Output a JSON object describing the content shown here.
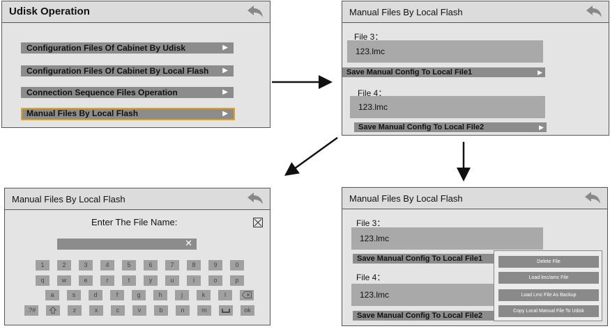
{
  "panel1": {
    "title": "Udisk Operation",
    "items": [
      "Configuration Files Of Cabinet By Udisk",
      "Configuration Files Of Cabinet By Local Flash",
      "Connection Sequence Files Operation",
      "Manual Files By Local Flash"
    ],
    "selected_index": 3
  },
  "panel2": {
    "title": "Manual Files By Local Flash",
    "file3_label": "File 3：",
    "file3_value": "123.lmc",
    "save1": "Save Manual Config To Local File1",
    "file4_label": "File 4：",
    "file4_value": "123.lmc",
    "save2": "Save Manual Config To Local File2"
  },
  "panel3": {
    "title": "Manual Files By Local Flash",
    "prompt": "Enter The File Name:",
    "input_value": "",
    "keyboard": {
      "row1": [
        "1",
        "2",
        "3",
        "4",
        "5",
        "6",
        "7",
        "8",
        "9",
        "0"
      ],
      "row2": [
        "q",
        "w",
        "e",
        "r",
        "t",
        "y",
        "u",
        "i",
        "o",
        "p"
      ],
      "row3": [
        "a",
        "s",
        "d",
        "f",
        "g",
        "h",
        "j",
        "k",
        "l"
      ],
      "row4": [
        ".?#",
        "z",
        "x",
        "c",
        "v",
        "b",
        "n",
        "m",
        "ok"
      ]
    }
  },
  "panel4": {
    "title": "Manual Files By Local Flash",
    "file3_label": "File 3：",
    "file3_value": "123.lmc",
    "save1": "Save Manual Config To Local File1",
    "file4_label": "File 4：",
    "file4_value": "123.lmc",
    "save2": "Save Manual Config To Local File2",
    "context_menu": [
      "Delete File",
      "Load lmc/amc File",
      "Load Lmc File As Backup",
      "Copy Local Manual File To Udisk"
    ]
  },
  "icons": {
    "back": "back-arrow-icon",
    "submenu": "triangle-right-icon",
    "clear": "clear-x-icon",
    "close": "close-box-icon",
    "backspace": "backspace-icon",
    "shift": "shift-icon",
    "space": "space-icon"
  },
  "colors": {
    "panel_bg": "#e4e4e4",
    "row_bg": "#8c8c8c",
    "field_bg": "#a9a9a9",
    "highlight": "#e0a020",
    "key_bg": "#a0a0a0"
  }
}
